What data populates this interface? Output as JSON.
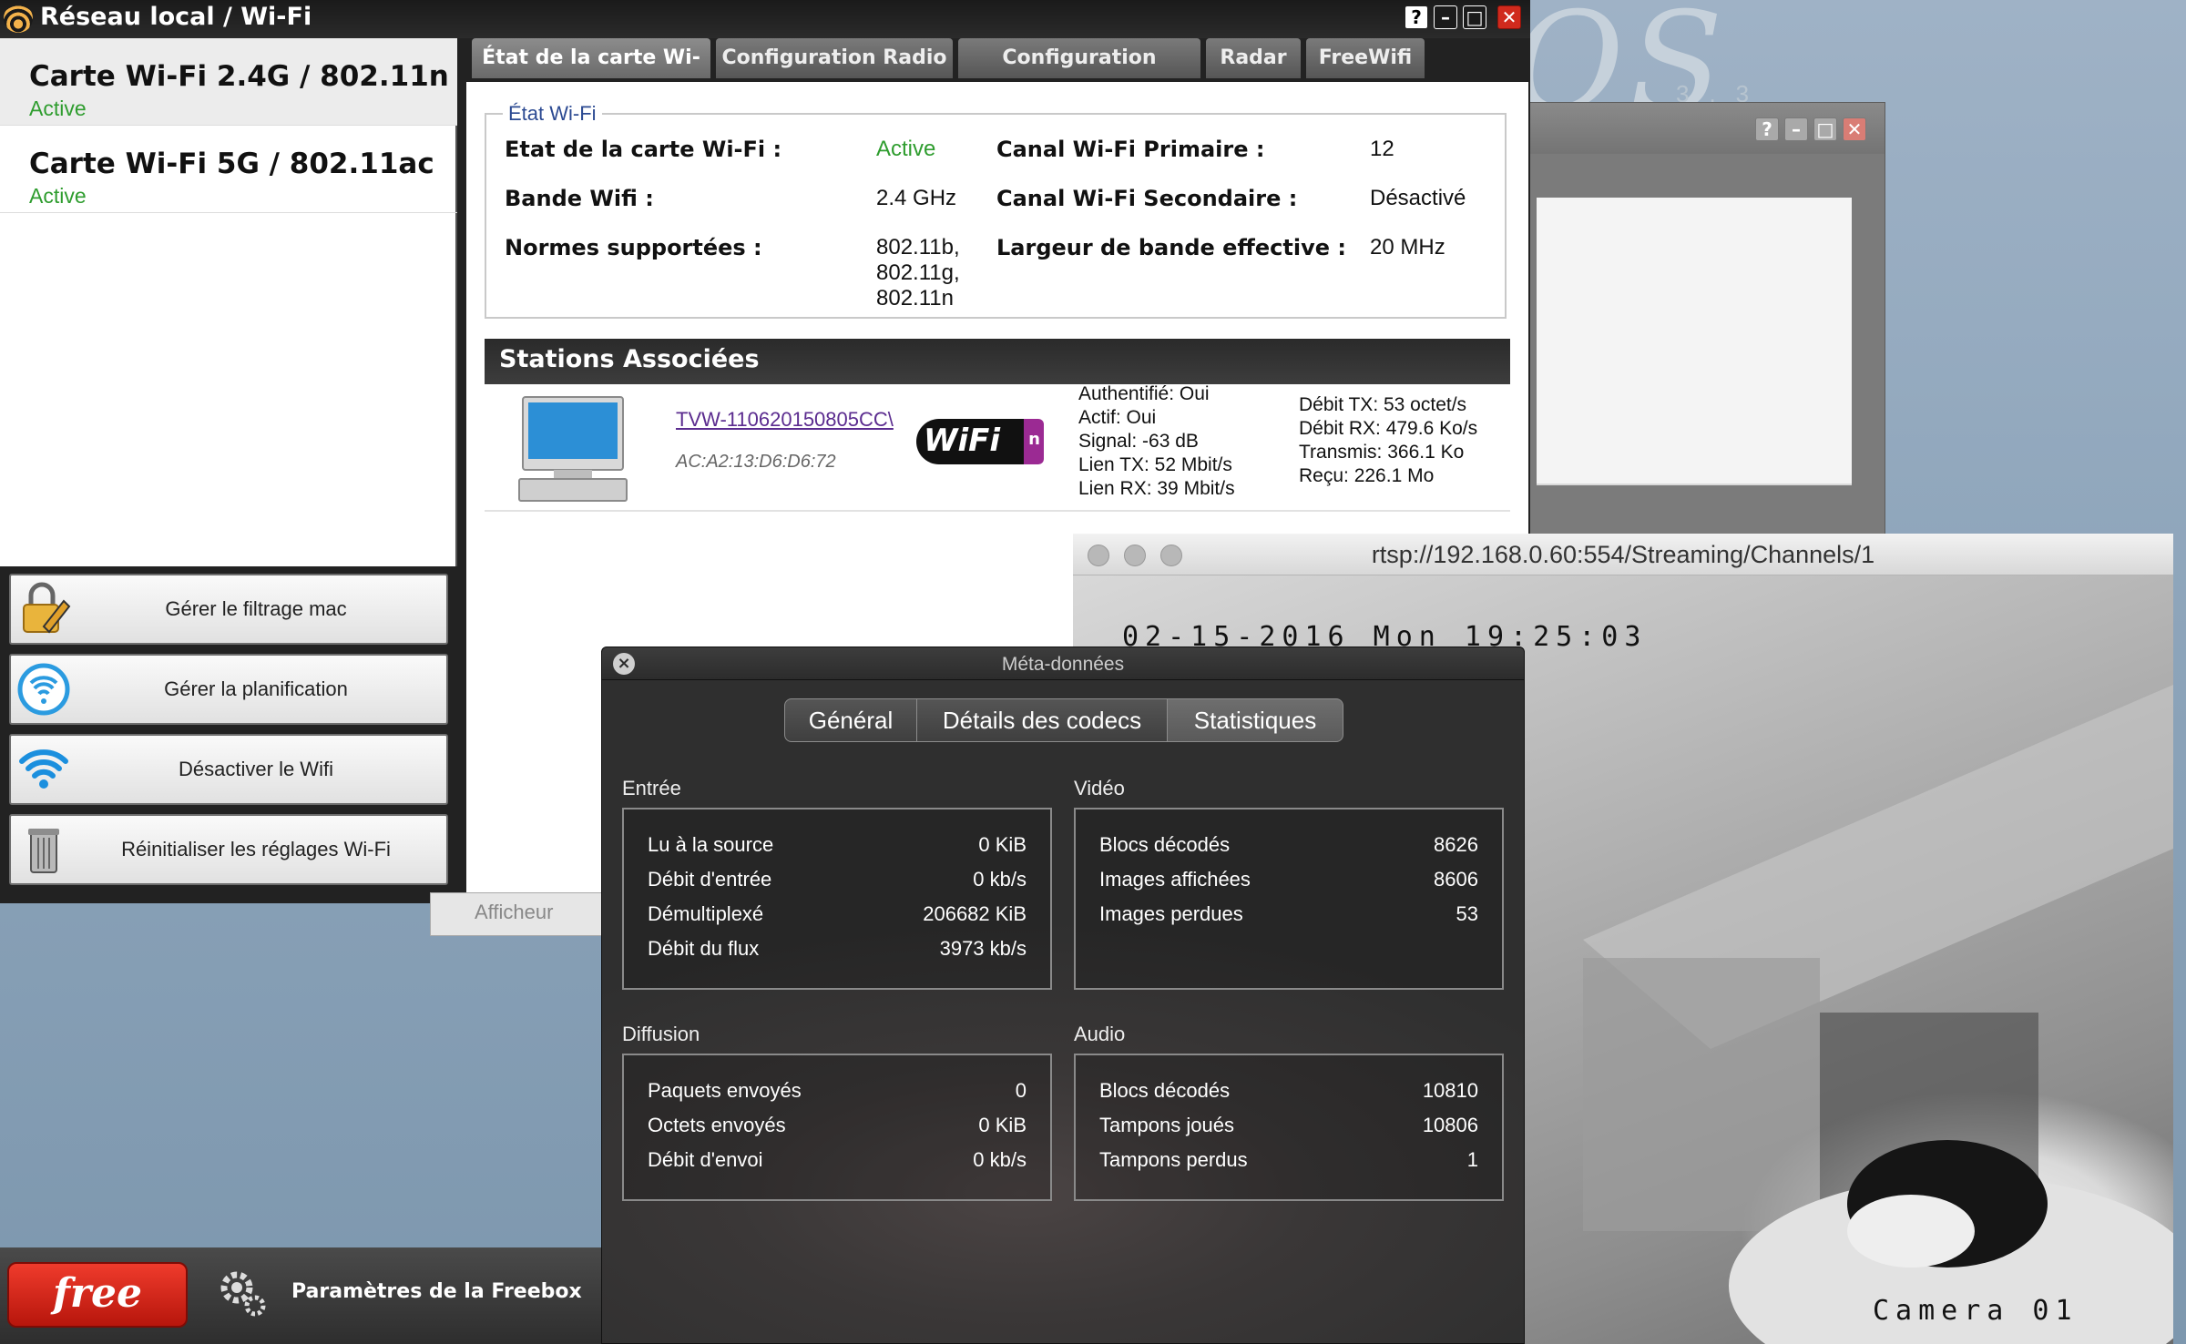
{
  "desktop": {
    "logo": "OS",
    "version": "3.3"
  },
  "main_window": {
    "title": "Réseau local / Wi-Fi",
    "controls": {
      "help": "?",
      "minimize": "–",
      "maximize": "□",
      "close": "✕"
    }
  },
  "cards": [
    {
      "title": "Carte Wi-Fi 2.4G / 802.11n",
      "status": "Active"
    },
    {
      "title": "Carte Wi-Fi 5G / 802.11ac",
      "status": "Active"
    }
  ],
  "actions": [
    {
      "label": "Gérer le filtrage mac",
      "icon": "lock-pen-icon"
    },
    {
      "label": "Gérer la planification",
      "icon": "wifi-clock-icon"
    },
    {
      "label": "Désactiver le Wifi",
      "icon": "wifi-icon"
    },
    {
      "label": "Réinitialiser les réglages Wi-Fi",
      "icon": "trash-icon"
    }
  ],
  "tabs": [
    "État de la carte Wi-Fi",
    "Configuration Radio",
    "Configuration Réseau",
    "Radar",
    "FreeWifi"
  ],
  "etat": {
    "legend": "État Wi-Fi",
    "etat_label": "Etat de la carte Wi-Fi :",
    "etat_value": "Active",
    "bande_label": "Bande Wifi :",
    "bande_value": "2.4 GHz",
    "normes_label": "Normes supportées :",
    "normes_value": [
      "802.11b,",
      "802.11g,",
      "802.11n"
    ],
    "canal1_label": "Canal Wi-Fi Primaire :",
    "canal1_value": "12",
    "canal2_label": "Canal Wi-Fi Secondaire :",
    "canal2_value": "Désactivé",
    "largeur_label": "Largeur de bande effective :",
    "largeur_value": "20 MHz"
  },
  "stations": {
    "header": "Stations Associées",
    "name": "TVW-110620150805CC\\",
    "mac": "AC:A2:13:D6:D6:72",
    "wifi_logo": "WiFi",
    "wifi_logo_suffix": "n",
    "info": [
      "Authentifié: Oui",
      "Actif: Oui",
      "Signal: -63 dB",
      "Lien TX: 52 Mbit/s",
      "Lien RX: 39 Mbit/s"
    ],
    "rates": [
      "Débit TX: 53 octet/s",
      "Débit RX: 479.6 Ko/s",
      "Transmis: 366.1 Ko",
      "Reçu: 226.1 Mo"
    ]
  },
  "afficheur": "Afficheur",
  "taskbar": {
    "free_label": "free",
    "param_label": "Paramètres de la Freebox"
  },
  "rtsp": {
    "title": "rtsp://192.168.0.60:554/Streaming/Channels/1",
    "osd_time": "02-15-2016 Mon 19:25:03",
    "osd_camera": "Camera 01"
  },
  "meta": {
    "title": "Méta-données",
    "segments": [
      "Général",
      "Détails des codecs",
      "Statistiques"
    ],
    "selected_segment": "Détails des codecs",
    "entree": {
      "title": "Entrée",
      "rows": [
        {
          "label": "Lu à la source",
          "value": "0 KiB"
        },
        {
          "label": "Débit d'entrée",
          "value": "0 kb/s"
        },
        {
          "label": "Démultiplexé",
          "value": "206682 KiB"
        },
        {
          "label": "Débit du flux",
          "value": "3973 kb/s"
        }
      ]
    },
    "video": {
      "title": "Vidéo",
      "rows": [
        {
          "label": "Blocs décodés",
          "value": "8626"
        },
        {
          "label": "Images affichées",
          "value": "8606"
        },
        {
          "label": "Images perdues",
          "value": "53"
        }
      ]
    },
    "diffusion": {
      "title": "Diffusion",
      "rows": [
        {
          "label": "Paquets envoyés",
          "value": "0"
        },
        {
          "label": "Octets envoyés",
          "value": "0 KiB"
        },
        {
          "label": "Débit d'envoi",
          "value": "0 kb/s"
        }
      ]
    },
    "audio": {
      "title": "Audio",
      "rows": [
        {
          "label": "Blocs décodés",
          "value": "10810"
        },
        {
          "label": "Tampons joués",
          "value": "10806"
        },
        {
          "label": "Tampons perdus",
          "value": "1"
        }
      ]
    }
  }
}
